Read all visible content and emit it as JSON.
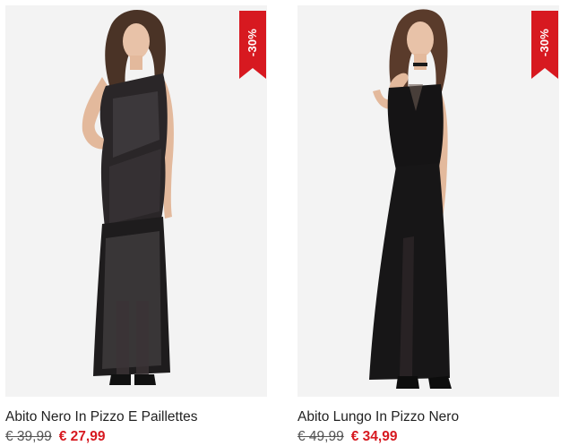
{
  "colors": {
    "sale_red": "#d71920",
    "image_background": "#f3f3f3",
    "text": "#222222",
    "old_price": "#555555"
  },
  "products": [
    {
      "name": "Abito Nero In Pizzo E Paillettes",
      "old_price": "€ 39,99",
      "new_price": "€ 27,99",
      "discount_badge": "-30%",
      "image_description_icon": "one-shoulder-sequin-lace-black-dress-photo"
    },
    {
      "name": "Abito Lungo In Pizzo Nero",
      "old_price": "€ 49,99",
      "new_price": "€ 34,99",
      "discount_badge": "-30%",
      "image_description_icon": "long-black-lace-dress-with-slit-photo"
    }
  ]
}
